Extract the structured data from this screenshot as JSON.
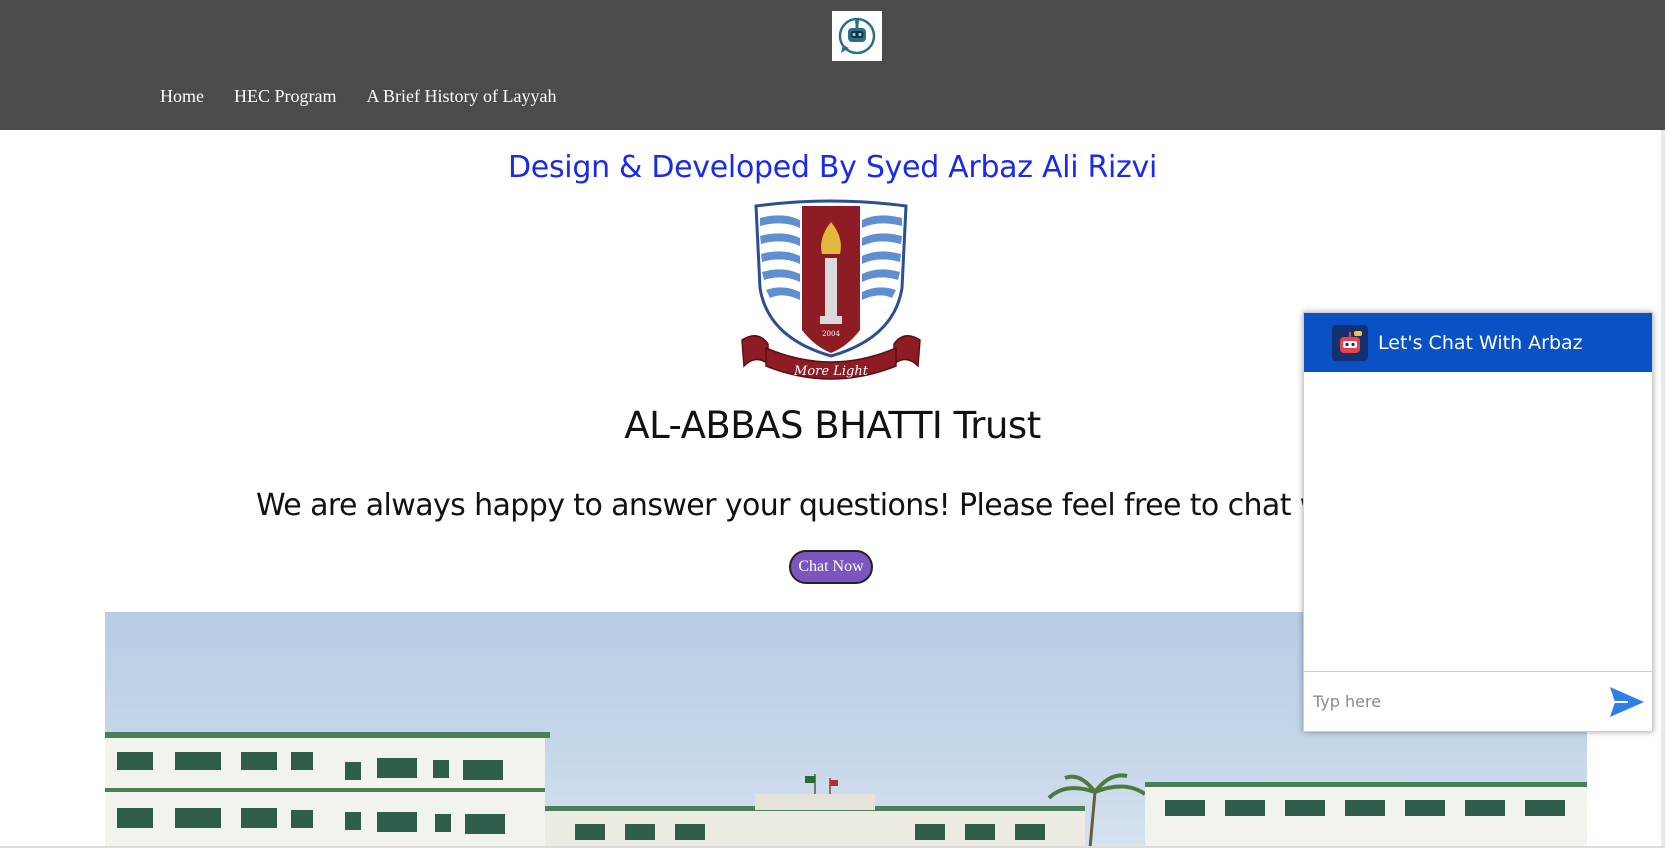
{
  "header": {
    "logo_icon": "chatbot-logo-icon",
    "nav": [
      {
        "label": "Home"
      },
      {
        "label": "HEC Program"
      },
      {
        "label": "A Brief History of Layyah"
      }
    ]
  },
  "main": {
    "credit": "Design & Developed By Syed Arbaz Ali Rizvi",
    "crest": {
      "year": "2004",
      "motto": "More Light"
    },
    "trust_name": "AL-ABBAS BHATTI Trust",
    "tagline": "We are always happy to answer your questions! Please feel free to chat w",
    "chat_now_label": "Chat Now",
    "photo_icon": "building-photo"
  },
  "chat_widget": {
    "title": "Let's Chat With Arbaz",
    "input_placeholder": "Typ here",
    "send_icon": "send-icon",
    "header_color": "#0a51c6",
    "send_color": "#2f7fe6"
  },
  "colors": {
    "topbar": "#4b4b4b",
    "credit_text": "#1a2be8",
    "chat_now_button": "#7b56c0"
  }
}
